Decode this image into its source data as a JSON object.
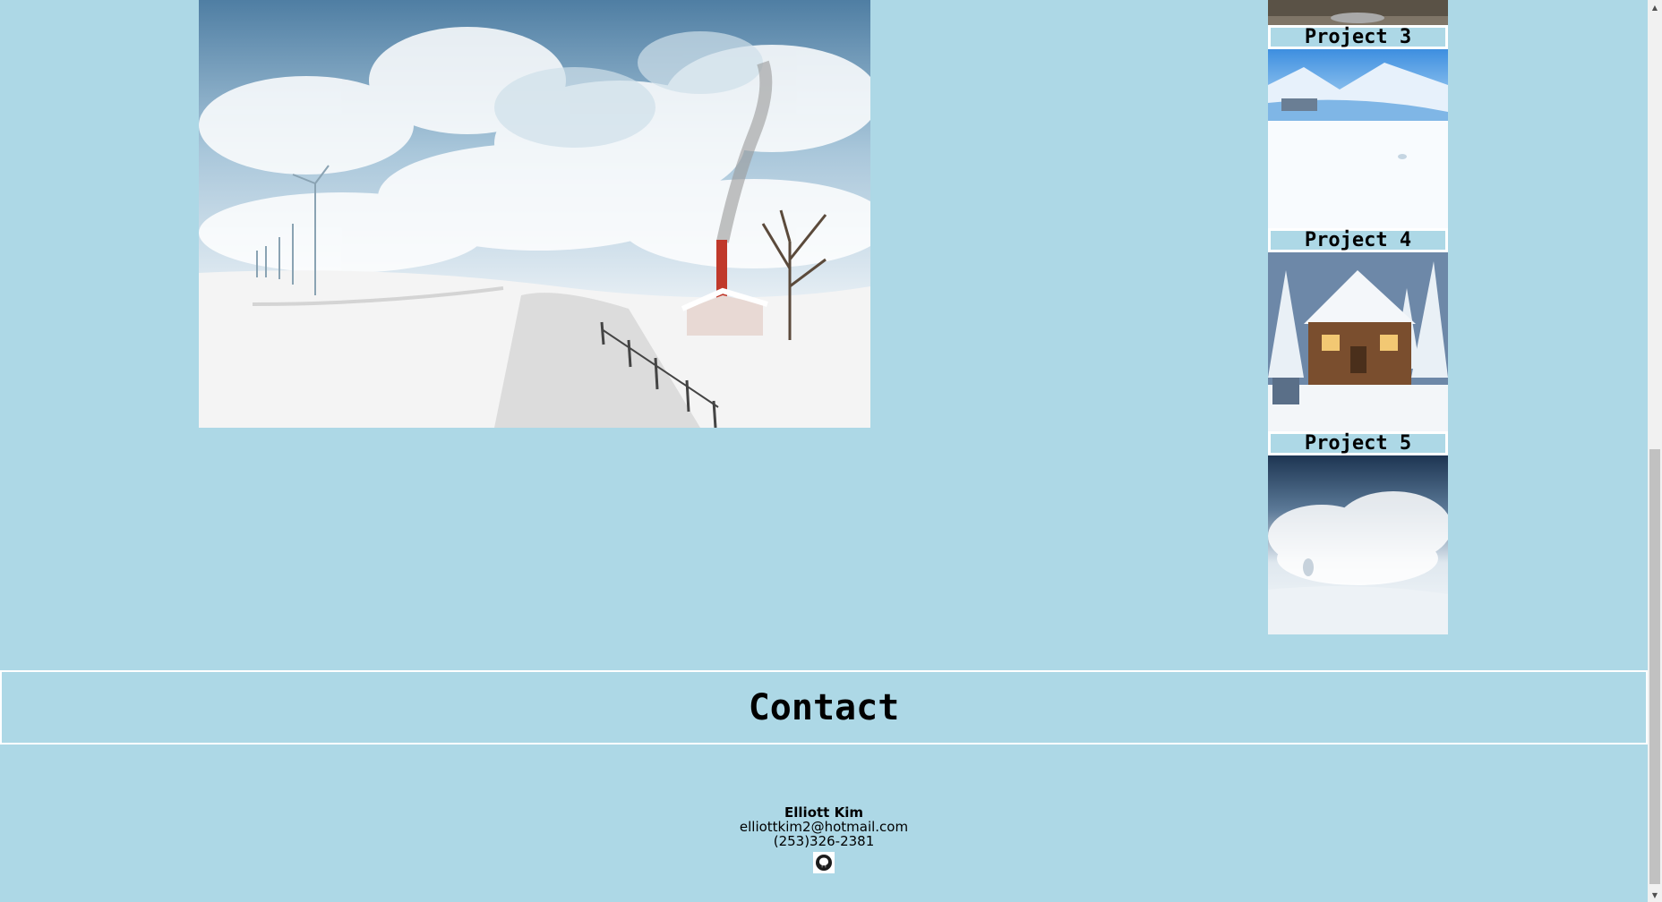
{
  "projects": [
    {
      "label": "Project 3",
      "thumb": "snowy-village-valley"
    },
    {
      "label": "Project 4",
      "thumb": "snowy-log-cabin"
    },
    {
      "label": "Project 5",
      "thumb": "snow-cloud-landscape"
    }
  ],
  "main_image": {
    "subject": "winter-landscape-windmills-cottage"
  },
  "contact": {
    "title": "Contact",
    "name": "Elliott Kim",
    "email": "elliottkim2@hotmail.com",
    "phone": "(253)326-2381",
    "github_icon": "github-icon"
  },
  "colors": {
    "background": "#add8e6",
    "border": "#ffffff"
  }
}
